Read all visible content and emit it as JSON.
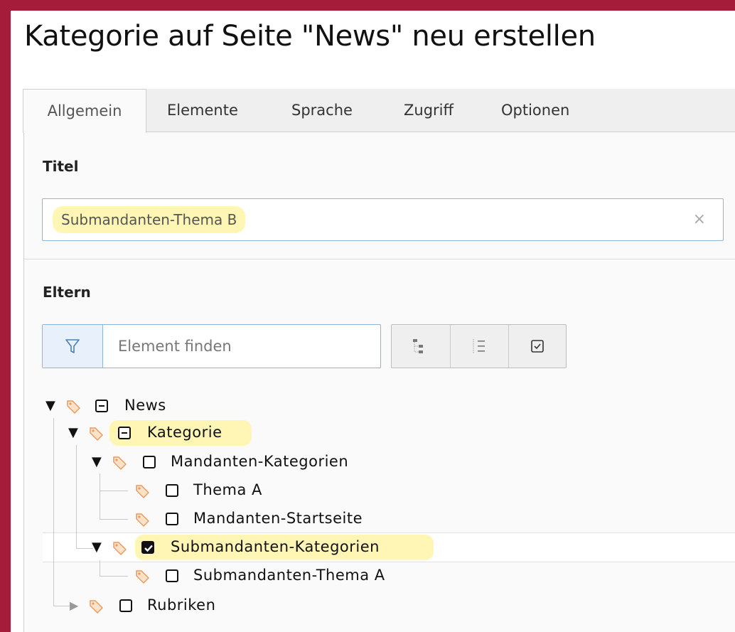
{
  "page": {
    "title": "Kategorie auf Seite \"News\" neu erstellen"
  },
  "tabs": [
    {
      "label": "Allgemein",
      "active": true
    },
    {
      "label": "Elemente",
      "active": false
    },
    {
      "label": "Sprache",
      "active": false
    },
    {
      "label": "Zugriff",
      "active": false
    },
    {
      "label": "Optionen",
      "active": false
    }
  ],
  "form": {
    "title_label": "Titel",
    "title_value": "Submandanten-Thema B",
    "clear_icon": "×",
    "parent_label": "Eltern",
    "filter_placeholder": "Element finden"
  },
  "toolbar_icons": [
    "tree-expand-icon",
    "list-icon",
    "checkbox-icon"
  ],
  "tree": [
    {
      "label": "News",
      "state": "indeterminate",
      "expanded": true
    },
    {
      "label": "Kategorie",
      "state": "indeterminate",
      "expanded": true,
      "highlight": true
    },
    {
      "label": "Mandanten-Kategorien",
      "state": "unchecked",
      "expanded": true
    },
    {
      "label": "Thema A",
      "state": "unchecked"
    },
    {
      "label": "Mandanten-Startseite",
      "state": "unchecked"
    },
    {
      "label": "Submandanten-Kategorien",
      "state": "checked",
      "expanded": true,
      "highlight": true
    },
    {
      "label": "Submandanten-Thema A",
      "state": "unchecked"
    },
    {
      "label": "Rubriken",
      "state": "unchecked",
      "expanded": false
    }
  ],
  "colors": {
    "frame": "#a41c3a",
    "highlight": "#fff6b5",
    "focus_border": "#8db4d9",
    "tag_icon": "#f0a060"
  }
}
